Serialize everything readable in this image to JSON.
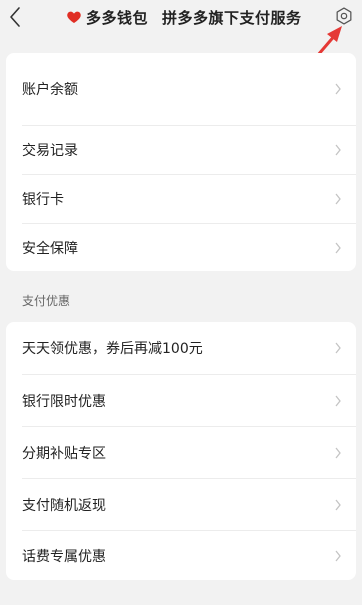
{
  "header": {
    "brand_name": "多多钱包",
    "brand_sub": "拼多多旗下支付服务",
    "back_icon": "chevron-left-icon",
    "heart_icon": "heart-icon",
    "settings_icon": "gear-icon",
    "heart_color": "#e02e24"
  },
  "account_card": {
    "items": [
      {
        "label": "账户余额"
      },
      {
        "label": "交易记录"
      },
      {
        "label": "银行卡"
      },
      {
        "label": "安全保障"
      }
    ]
  },
  "promotions": {
    "section_title": "支付优惠",
    "items": [
      {
        "label": "天天领优惠，券后再减100元"
      },
      {
        "label": "银行限时优惠"
      },
      {
        "label": "分期补贴专区"
      },
      {
        "label": "支付随机返现"
      },
      {
        "label": "话费专属优惠"
      }
    ]
  },
  "annotation": {
    "arrow_color": "#e53935"
  }
}
